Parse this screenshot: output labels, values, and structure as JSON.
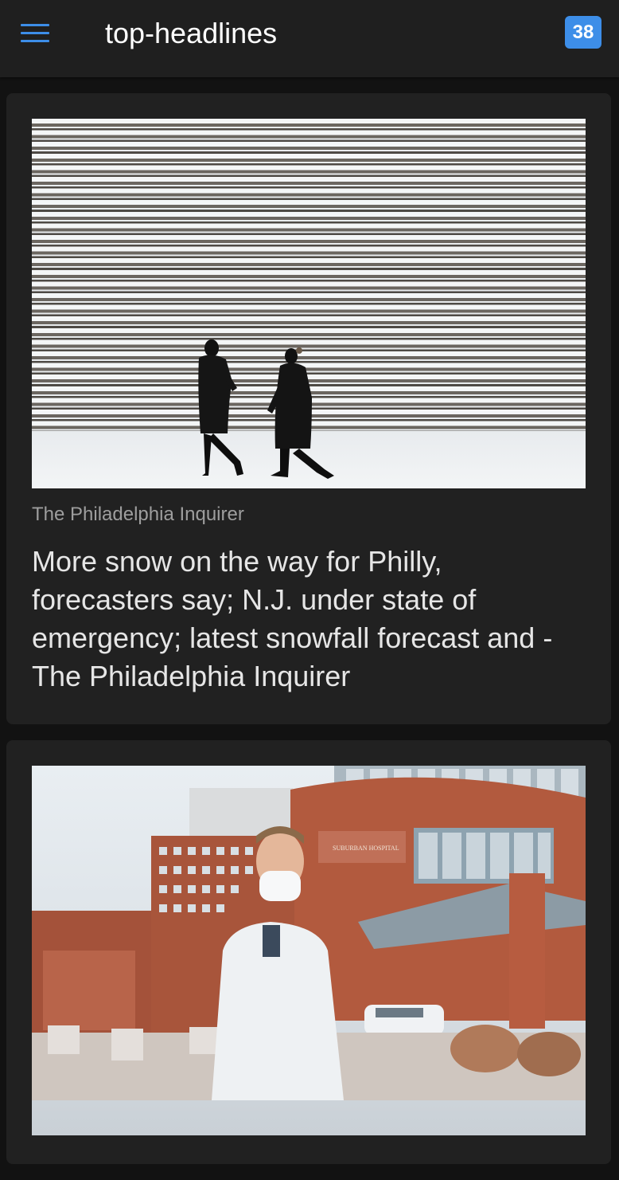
{
  "header": {
    "title": "top-headlines",
    "count_badge": "38"
  },
  "articles": [
    {
      "source": "The Philadelphia Inquirer",
      "title": "More snow on the way for Philly, forecasters say; N.J. under state of emergency; latest snowfall forecast and - The Philadelphia Inquirer",
      "image": "snow-steps-photo"
    },
    {
      "source": "",
      "title": "",
      "image": "hospital-doctor-photo",
      "image_sign_text": "SUBURBAN HOSPITAL"
    }
  ],
  "colors": {
    "accent": "#3d8ee8",
    "appbar": "#1f1f1f",
    "card": "#212121",
    "background": "#121212"
  }
}
